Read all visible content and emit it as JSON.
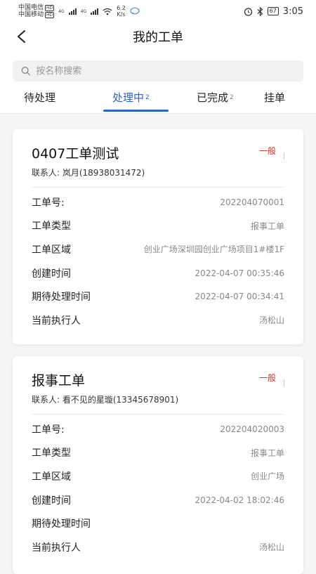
{
  "status_bar": {
    "carrier1": "中国电信",
    "carrier2": "中国移动",
    "hd": "HD",
    "net": "4G",
    "speed_value": "6.2",
    "speed_unit": "K/s",
    "battery": "67",
    "time": "3:05"
  },
  "header": {
    "title": "我的工单"
  },
  "search": {
    "placeholder": "按名称搜索"
  },
  "tabs": [
    {
      "label": "待处理",
      "count": ""
    },
    {
      "label": "处理中",
      "count": "2"
    },
    {
      "label": "已完成",
      "count": "2"
    },
    {
      "label": "挂单",
      "count": ""
    }
  ],
  "cards": [
    {
      "title": "0407工单测试",
      "priority": "一般",
      "contact": "联系人: 岚月(18938031472)",
      "fields": [
        {
          "label": "工单号:",
          "value": "202204070001"
        },
        {
          "label": "工单类型",
          "value": "报事工单"
        },
        {
          "label": "工单区域",
          "value": "创业广场深圳园创业广场项目1#楼1F"
        },
        {
          "label": "创建时间",
          "value": "2022-04-07 00:35:46"
        },
        {
          "label": "期待处理时间",
          "value": "2022-04-07 00:34:41"
        },
        {
          "label": "当前执行人",
          "value": "汤松山"
        }
      ]
    },
    {
      "title": "报事工单",
      "priority": "一般",
      "contact": "联系人: 看不见的星璇(13345678901)",
      "fields": [
        {
          "label": "工单号:",
          "value": "202204020003"
        },
        {
          "label": "工单类型",
          "value": "报事工单"
        },
        {
          "label": "工单区域",
          "value": "创业广场"
        },
        {
          "label": "创建时间",
          "value": "2022-04-02 18:02:46"
        },
        {
          "label": "期待处理时间",
          "value": ""
        },
        {
          "label": "当前执行人",
          "value": "汤松山"
        }
      ]
    }
  ],
  "colors": {
    "accent": "#2a64c4",
    "priority": "#c0392b"
  },
  "icons": {
    "back": "chevron-left-icon",
    "search": "search-icon"
  }
}
